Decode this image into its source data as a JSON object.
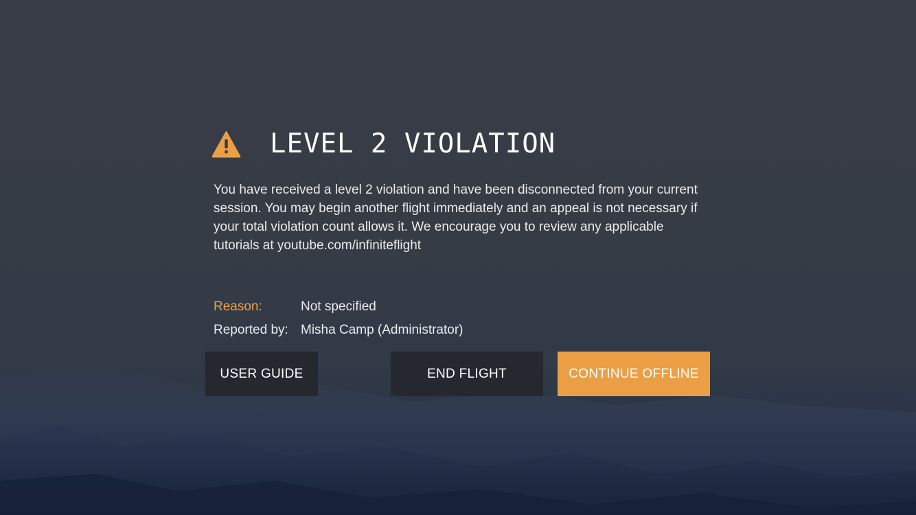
{
  "colors": {
    "accent": "#eb9f45",
    "button_dark": "#25292f",
    "text": "#e9ebee",
    "background": "#373c46"
  },
  "dialog": {
    "icon": "warning-triangle-icon",
    "title": "LEVEL 2 VIOLATION",
    "message": "You have received a level 2 violation and have been disconnected from your current session. You may begin another flight immediately and an appeal is not necessary if your total violation count allows it. We encourage you to review any applicable tutorials at youtube.com/infiniteflight",
    "reason_label": "Reason:",
    "reason_value": "Not specified",
    "reported_label": "Reported by:",
    "reported_value": "Misha Camp (Administrator)"
  },
  "buttons": {
    "user_guide": "USER GUIDE",
    "end_flight": "END FLIGHT",
    "continue_offline": "CONTINUE OFFLINE"
  }
}
